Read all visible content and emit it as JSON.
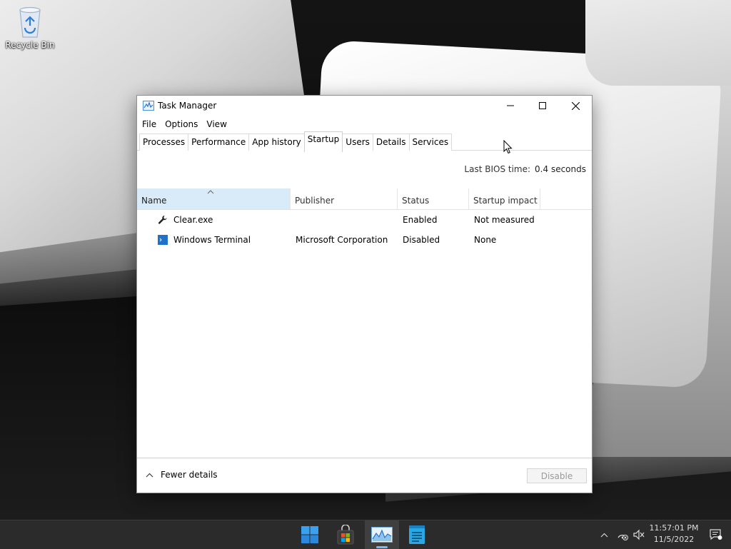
{
  "desktop": {
    "recycle_bin_label": "Recycle Bin"
  },
  "window": {
    "title": "Task Manager",
    "menu": [
      "File",
      "Options",
      "View"
    ],
    "tabs": [
      "Processes",
      "Performance",
      "App history",
      "Startup",
      "Users",
      "Details",
      "Services"
    ],
    "active_tab": "Startup",
    "bios_label": "Last BIOS time:",
    "bios_value": "0.4 seconds",
    "columns": [
      "Name",
      "Publisher",
      "Status",
      "Startup impact"
    ],
    "sort_column": "Name",
    "rows": [
      {
        "icon": "wrench-icon",
        "name": "Clear.exe",
        "publisher": "",
        "status": "Enabled",
        "impact": "Not measured"
      },
      {
        "icon": "windows-terminal-icon",
        "name": "Windows Terminal",
        "publisher": "Microsoft Corporation",
        "status": "Disabled",
        "impact": "None"
      }
    ],
    "fewer_details": "Fewer details",
    "disable_button": "Disable"
  },
  "taskbar": {
    "apps": [
      "start-icon",
      "microsoft-store-icon",
      "task-manager-icon",
      "notepad-icon"
    ],
    "active_app": "task-manager-icon",
    "time": "11:57:01 PM",
    "date": "11/5/2022"
  },
  "colors": {
    "selected_header_bg": "#d9ebf9",
    "taskbar_bg": "#2b2b2b",
    "accent": "#7ab8f0"
  }
}
